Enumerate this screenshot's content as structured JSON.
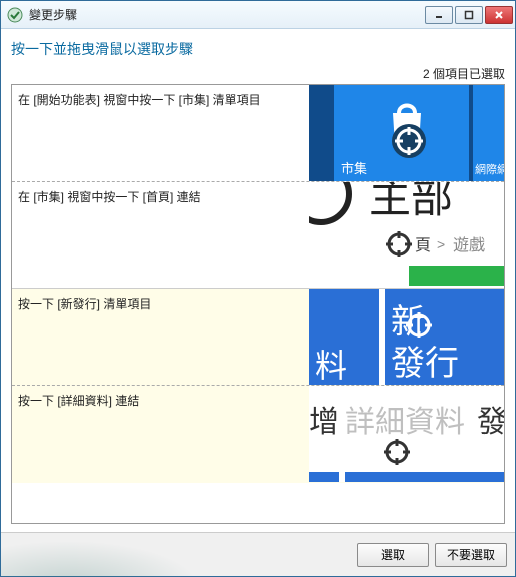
{
  "window": {
    "title": "變更步驟"
  },
  "instruction": "按一下並拖曳滑鼠以選取步驟",
  "selection_status": "2 個項目已選取",
  "steps": [
    {
      "description": "在 [開始功能表] 視窗中按一下 [市集] 清單項目",
      "selected": false,
      "thumb": {
        "tile_label": "市集",
        "tile_label_right": "網際網"
      }
    },
    {
      "description": "在 [市集] 視窗中按一下 [首頁] 連結",
      "selected": false,
      "thumb": {
        "big_text": "主部",
        "badge": "頁",
        "crumb_sep": ">",
        "crumb_next": "遊戲"
      }
    },
    {
      "description": "按一下 [新發行] 清單項目",
      "selected": true,
      "thumb": {
        "left_text": "料",
        "right_line1": "新",
        "right_line2": "發行"
      }
    },
    {
      "description": "按一下 [詳細資料] 連結",
      "selected": true,
      "thumb": {
        "left_char": "增",
        "mid_text": "詳細資料",
        "right_char": "發"
      }
    }
  ],
  "buttons": {
    "select": "選取",
    "deselect": "不要選取"
  }
}
